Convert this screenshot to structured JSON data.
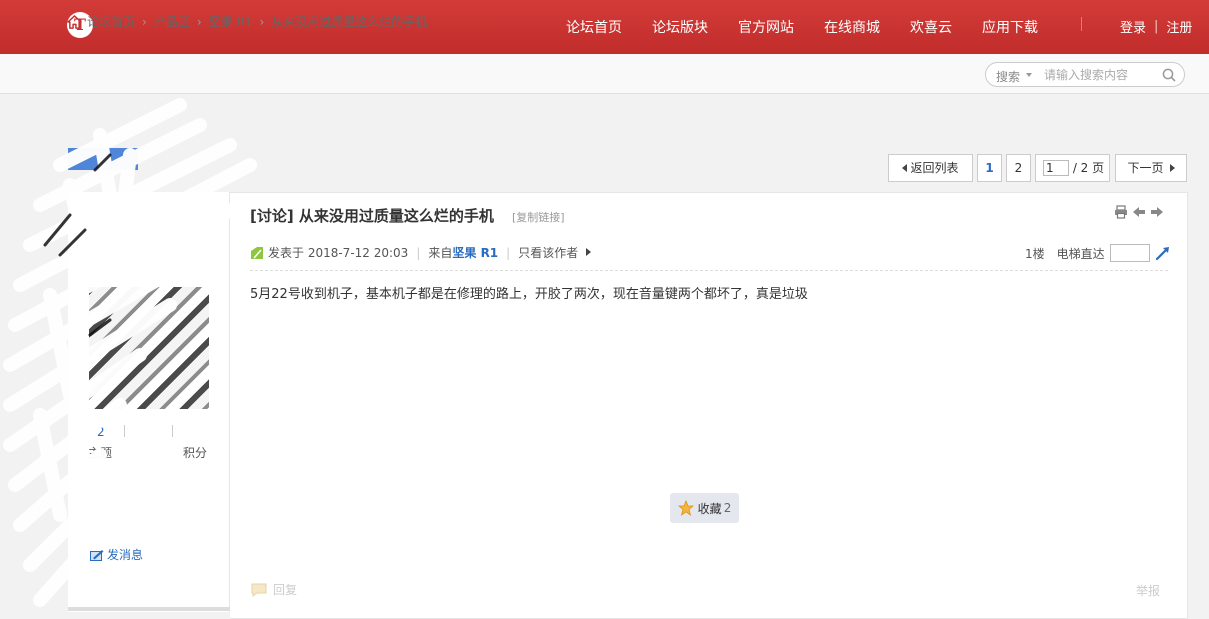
{
  "header": {
    "logo_text": "T",
    "nav": [
      "论坛首页",
      "论坛版块",
      "官方网站",
      "在线商城",
      "欢喜云",
      "应用下载"
    ],
    "login": "登录",
    "register": "注册",
    "auth_sep": "|"
  },
  "breadcrumb": {
    "items": [
      "论坛首页",
      "产品区",
      "坚果 R1",
      "从来没用过质量这么烂的手机"
    ],
    "sep": "›"
  },
  "search": {
    "type": "搜索",
    "placeholder": "请输入搜索内容"
  },
  "pager": {
    "back": "返回列表",
    "pages": [
      "1",
      "2"
    ],
    "current": "1",
    "total": "/ 2 页",
    "next": "下一页"
  },
  "author": {
    "stat_value": "2",
    "label_topics": "主题",
    "label_points": "积分",
    "send_message": "发消息"
  },
  "post": {
    "title": "[讨论] 从来没用过质量这么烂的手机",
    "copy_link": "[复制链接]",
    "posted_at": "发表于 2018-7-12 20:03",
    "from_label": "来自",
    "from_source": "坚果 R1",
    "only_author": "只看该作者",
    "floor": "1楼",
    "jump_label": "电梯直达",
    "body": "5月22号收到机子，基本机子都是在修理的路上，开胶了两次，现在音量键两个都坏了，真是垃圾",
    "favorite_label": "收藏",
    "favorite_count": "2",
    "reply": "回复",
    "report": "举报"
  },
  "colors": {
    "brand_red": "#c8302f",
    "link_blue": "#2a6cbf"
  }
}
